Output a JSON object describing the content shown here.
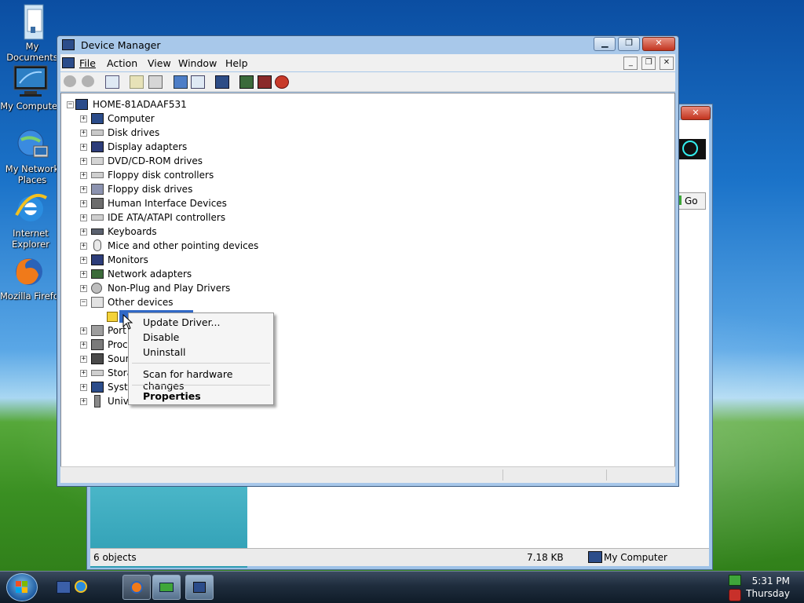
{
  "desktop": {
    "icons": [
      {
        "label": "My\nDocuments"
      },
      {
        "label": "My Computer"
      },
      {
        "label": "My Network\nPlaces"
      },
      {
        "label": "Internet\nExplorer"
      },
      {
        "label": "Mozilla Firefox"
      }
    ]
  },
  "background_window": {
    "go_label": "Go",
    "status": {
      "objects": "6 objects",
      "size": "7.18 KB",
      "location": "My Computer"
    }
  },
  "device_manager": {
    "title": "Device Manager",
    "menu": [
      {
        "label": "File"
      },
      {
        "label": "Action"
      },
      {
        "label": "View"
      },
      {
        "label": "Window"
      },
      {
        "label": "Help"
      }
    ],
    "tree": {
      "root": "HOME-81ADAAF531",
      "items": [
        {
          "label": "Computer",
          "expanded": false
        },
        {
          "label": "Disk drives",
          "expanded": false
        },
        {
          "label": "Display adapters",
          "expanded": false
        },
        {
          "label": "DVD/CD-ROM drives",
          "expanded": false
        },
        {
          "label": "Floppy disk controllers",
          "expanded": false
        },
        {
          "label": "Floppy disk drives",
          "expanded": false
        },
        {
          "label": "Human Interface Devices",
          "expanded": false
        },
        {
          "label": "IDE ATA/ATAPI controllers",
          "expanded": false
        },
        {
          "label": "Keyboards",
          "expanded": false
        },
        {
          "label": "Mice and other pointing devices",
          "expanded": false
        },
        {
          "label": "Monitors",
          "expanded": false
        },
        {
          "label": "Network adapters",
          "expanded": false
        },
        {
          "label": "Non-Plug and Play Drivers",
          "expanded": false
        },
        {
          "label": "Other devices",
          "expanded": true
        },
        {
          "label": "Port",
          "expanded": false
        },
        {
          "label": "Proc",
          "expanded": false
        },
        {
          "label": "Soun",
          "expanded": false
        },
        {
          "label": "Stora",
          "expanded": false
        },
        {
          "label": "Syste",
          "expanded": false
        },
        {
          "label": "Unive",
          "expanded": false
        }
      ]
    },
    "context_menu": {
      "items": [
        {
          "label": "Update Driver..."
        },
        {
          "label": "Disable"
        },
        {
          "label": "Uninstall"
        },
        {
          "label": "Scan for hardware changes"
        },
        {
          "label": "Properties"
        }
      ]
    }
  },
  "taskbar": {
    "clock_time": "5:31 PM",
    "clock_day": "Thursday"
  },
  "colors": {
    "selection": "#3169c6",
    "title_bar": "#a8c8ea",
    "close_button": "#c2341f"
  }
}
